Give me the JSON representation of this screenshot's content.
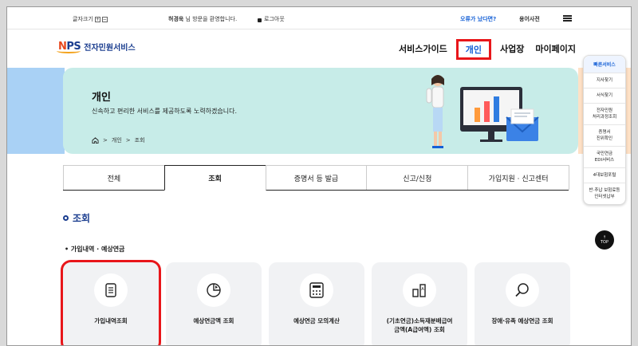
{
  "util": {
    "font_size_label": "글자크기",
    "font_plus": "+",
    "font_minus": "−",
    "user_name": "허경욱",
    "welcome_text": " 님 방문을 환영합니다.",
    "logout": "로그아웃",
    "forgot": "오류가 났다면?",
    "glossary": "용어사전"
  },
  "header": {
    "logo_mark_n": "N",
    "logo_mark_rest": "PS",
    "logo_text": "전자민원서비스",
    "gnb": [
      "서비스가이드",
      "개인",
      "사업장",
      "마이페이지"
    ]
  },
  "hero": {
    "title": "개인",
    "subtitle": "신속하고 편리한 서비스를 제공하도록 노력하겠습니다.",
    "breadcrumb": [
      "개인",
      "조회"
    ],
    "breadcrumb_sep": ">"
  },
  "tabs": [
    "전체",
    "조회",
    "증명서 등 발급",
    "신고/신청",
    "가입지원 · 신고센터"
  ],
  "section": {
    "title": "조회",
    "subtitle": "가입내역 · 예상연금"
  },
  "cards": [
    {
      "label": "가입내역조회",
      "icon": "document-icon"
    },
    {
      "label": "예상연금액 조회",
      "icon": "pie-chart-icon"
    },
    {
      "label": "예상연금 모의계산",
      "icon": "calculator-icon"
    },
    {
      "label": "(기초연금)소득재분배급여\n금액(A급여액) 조회",
      "icon": "bar-chart-icon"
    },
    {
      "label": "장애·유족 예상연금 조회",
      "icon": "magnifier-icon"
    }
  ],
  "quick_menu": {
    "head": "빠른서비스",
    "items": [
      "지사찾기",
      "서식찾기",
      "전자민원\n처리과정조회",
      "증명서\n진위확인",
      "국민연금\nEDI서비스",
      "4대보험포털",
      "반·추납 보험료등\n인터넷납부"
    ],
    "top": "TOP",
    "top_arrow": "↑"
  },
  "colors": {
    "accent_blue": "#1560d6",
    "highlight_red": "#e8161a",
    "hero_bg": "#c7ece8",
    "brand_navy": "#1a3d8f"
  }
}
